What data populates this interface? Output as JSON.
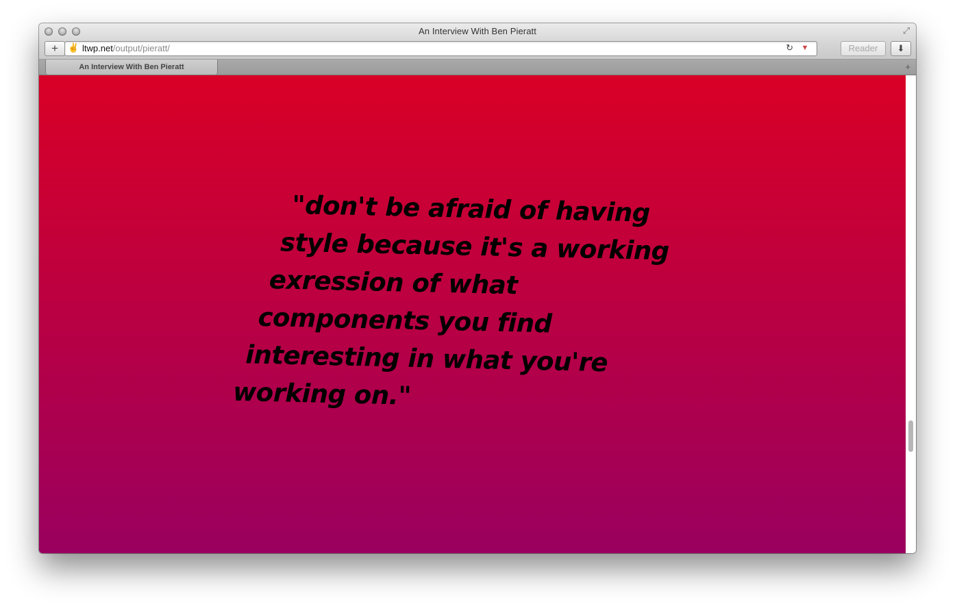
{
  "window": {
    "title": "An Interview With Ben Pieratt"
  },
  "toolbar": {
    "add_label": "+",
    "url_domain": "ltwp.net",
    "url_path": "/output/pieratt/",
    "reader_label": "Reader"
  },
  "tabs": [
    {
      "label": "An Interview With Ben Pieratt"
    }
  ],
  "page": {
    "quote_lines": [
      "\"don't be afraid of having",
      "style because it's a working",
      "exression of what",
      "components you find",
      "interesting in what you're",
      "working on.\""
    ],
    "background_top": "#d90026",
    "background_bottom": "#9a005f"
  },
  "icons": {
    "favicon": "peace-hand-icon",
    "reload": "reload-icon",
    "extension": "extension-icon",
    "download": "download-icon",
    "fullscreen": "fullscreen-icon",
    "new_tab": "new-tab-icon"
  }
}
